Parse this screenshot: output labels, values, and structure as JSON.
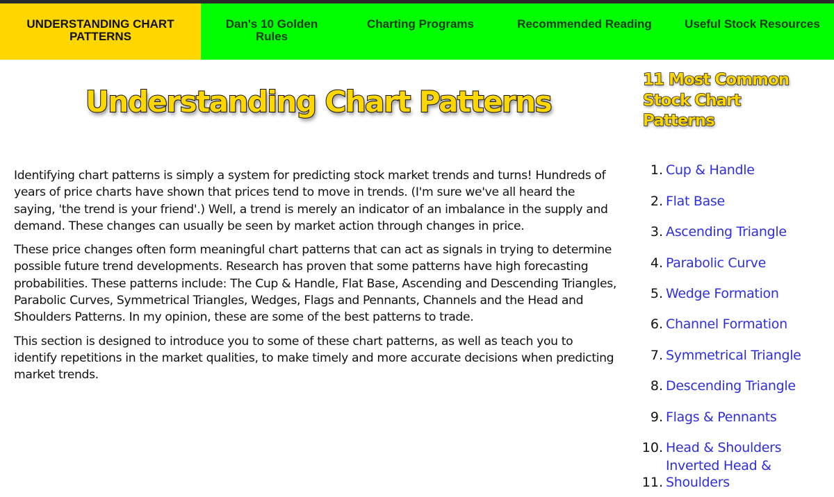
{
  "nav": {
    "items": [
      {
        "label_line1": "UNDERSTANDING CHART",
        "label_line2": "PATTERNS",
        "active": true
      },
      {
        "label_line1": "Dan's 10 Golden",
        "label_line2": "Rules",
        "active": false
      },
      {
        "label_line1": "Charting Programs",
        "label_line2": "",
        "active": false
      },
      {
        "label_line1": "Recommended Reading",
        "label_line2": "",
        "active": false
      },
      {
        "label_line1": "Useful Stock Resources",
        "label_line2": "",
        "active": false
      }
    ]
  },
  "colors": {
    "nav_bg": "#00ff00",
    "nav_active_bg": "#ffd700",
    "title_fill": "#ffd700",
    "link": "#2e2ee0"
  },
  "main": {
    "title": "Understanding Chart Patterns",
    "paragraphs": [
      "Identifying chart patterns is simply a system for predicting stock market trends and turns! Hundreds of years of price charts have shown that prices tend to move in trends. (I'm sure we've all heard the saying, 'the trend is your friend'.) Well, a trend is merely an indicator of an imbalance in the supply and demand. These changes can usually be seen by market action through changes in price.",
      "These price changes often form meaningful chart patterns that can act as signals in trying to determine possible future trend developments. Research has proven that some patterns have high forecasting probabilities. These patterns include: The Cup & Handle, Flat Base, Ascending and Descending Triangles, Parabolic Curves, Symmetrical Triangles, Wedges, Flags and Pennants, Channels and the Head and Shoulders Patterns. In my opinion, these are some of the best patterns to trade.",
      "This section is designed to introduce you to some of these chart patterns, as well as teach you to identify repetitions in the market qualities, to make timely and more accurate decisions when predicting market trends."
    ]
  },
  "sidebar": {
    "title_line1": "11 Most Common",
    "title_line2": "Stock Chart",
    "title_line3": "Patterns",
    "patterns": [
      {
        "num": "1.",
        "label": "Cup & Handle"
      },
      {
        "num": "2.",
        "label": "Flat Base"
      },
      {
        "num": "3.",
        "label": "Ascending Triangle"
      },
      {
        "num": "4.",
        "label": "Parabolic Curve"
      },
      {
        "num": "5.",
        "label": "Wedge Formation"
      },
      {
        "num": "6.",
        "label": "Channel Formation"
      },
      {
        "num": "7.",
        "label": "Symmetrical Triangle"
      },
      {
        "num": "8.",
        "label": "Descending Triangle"
      },
      {
        "num": "9.",
        "label": "Flags & Pennants"
      },
      {
        "num": "10.",
        "label": "Head & Shoulders"
      },
      {
        "num": "11.",
        "label": "Inverted Head & Shoulders"
      }
    ]
  }
}
